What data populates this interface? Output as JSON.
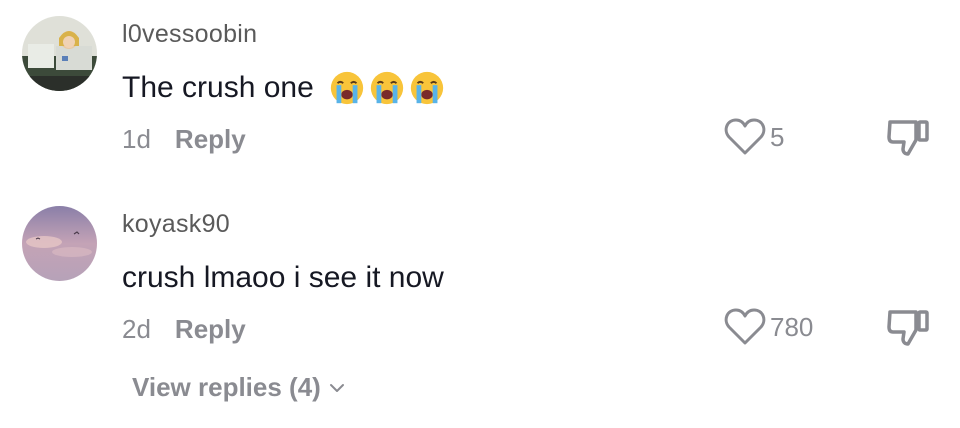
{
  "comments": [
    {
      "username": "l0vessoobin",
      "text": "The crush one",
      "emoji": [
        "loudly-crying-face",
        "loudly-crying-face",
        "loudly-crying-face"
      ],
      "age": "1d",
      "reply_label": "Reply",
      "likes": "5"
    },
    {
      "username": "koyask90",
      "text": "crush lmaoo i see it now",
      "age": "2d",
      "reply_label": "Reply",
      "likes": "780"
    }
  ],
  "view_replies": "View replies (4)",
  "icons": {
    "like": "heart-outline-icon",
    "dislike": "thumbs-down-icon",
    "expand": "chevron-down-icon"
  },
  "colors": {
    "text_primary": "#161823",
    "text_secondary": "#8a8b91",
    "username": "#5a5a5a"
  }
}
